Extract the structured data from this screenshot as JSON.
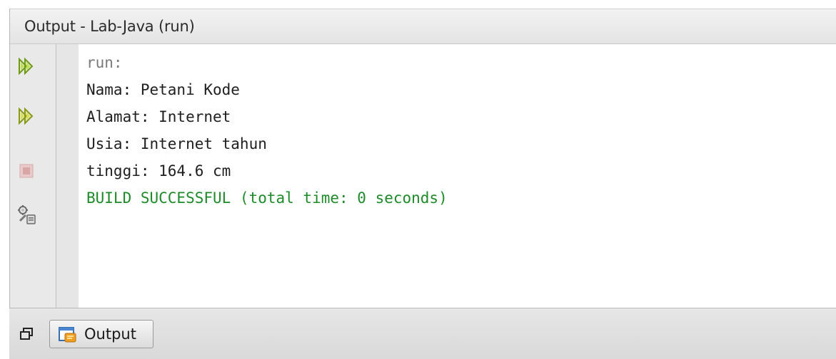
{
  "window": {
    "title": "Output - Lab-Java (run)"
  },
  "toolbar": {
    "buttons": [
      {
        "name": "rerun-icon",
        "enabled": true
      },
      {
        "name": "rerun-with-options-icon",
        "enabled": true
      },
      {
        "name": "stop-icon",
        "enabled": false
      },
      {
        "name": "settings-icon",
        "enabled": true
      }
    ]
  },
  "console": {
    "lines": [
      {
        "text": "run:",
        "kind": "run"
      },
      {
        "text": "Nama: Petani Kode",
        "kind": "normal"
      },
      {
        "text": "Alamat: Internet",
        "kind": "normal"
      },
      {
        "text": "Usia: Internet tahun",
        "kind": "normal"
      },
      {
        "text": "tinggi: 164.6 cm",
        "kind": "normal"
      },
      {
        "text": "BUILD SUCCESSFUL (total time: 0 seconds)",
        "kind": "success"
      }
    ]
  },
  "bottom": {
    "restore_icon": "restore-window-icon",
    "tab_label": "Output",
    "tab_icon": "output-window-icon"
  },
  "colors": {
    "success_text": "#1e8a2a",
    "run_text": "#7a7a7a",
    "play_icon": "#7fae1a"
  }
}
